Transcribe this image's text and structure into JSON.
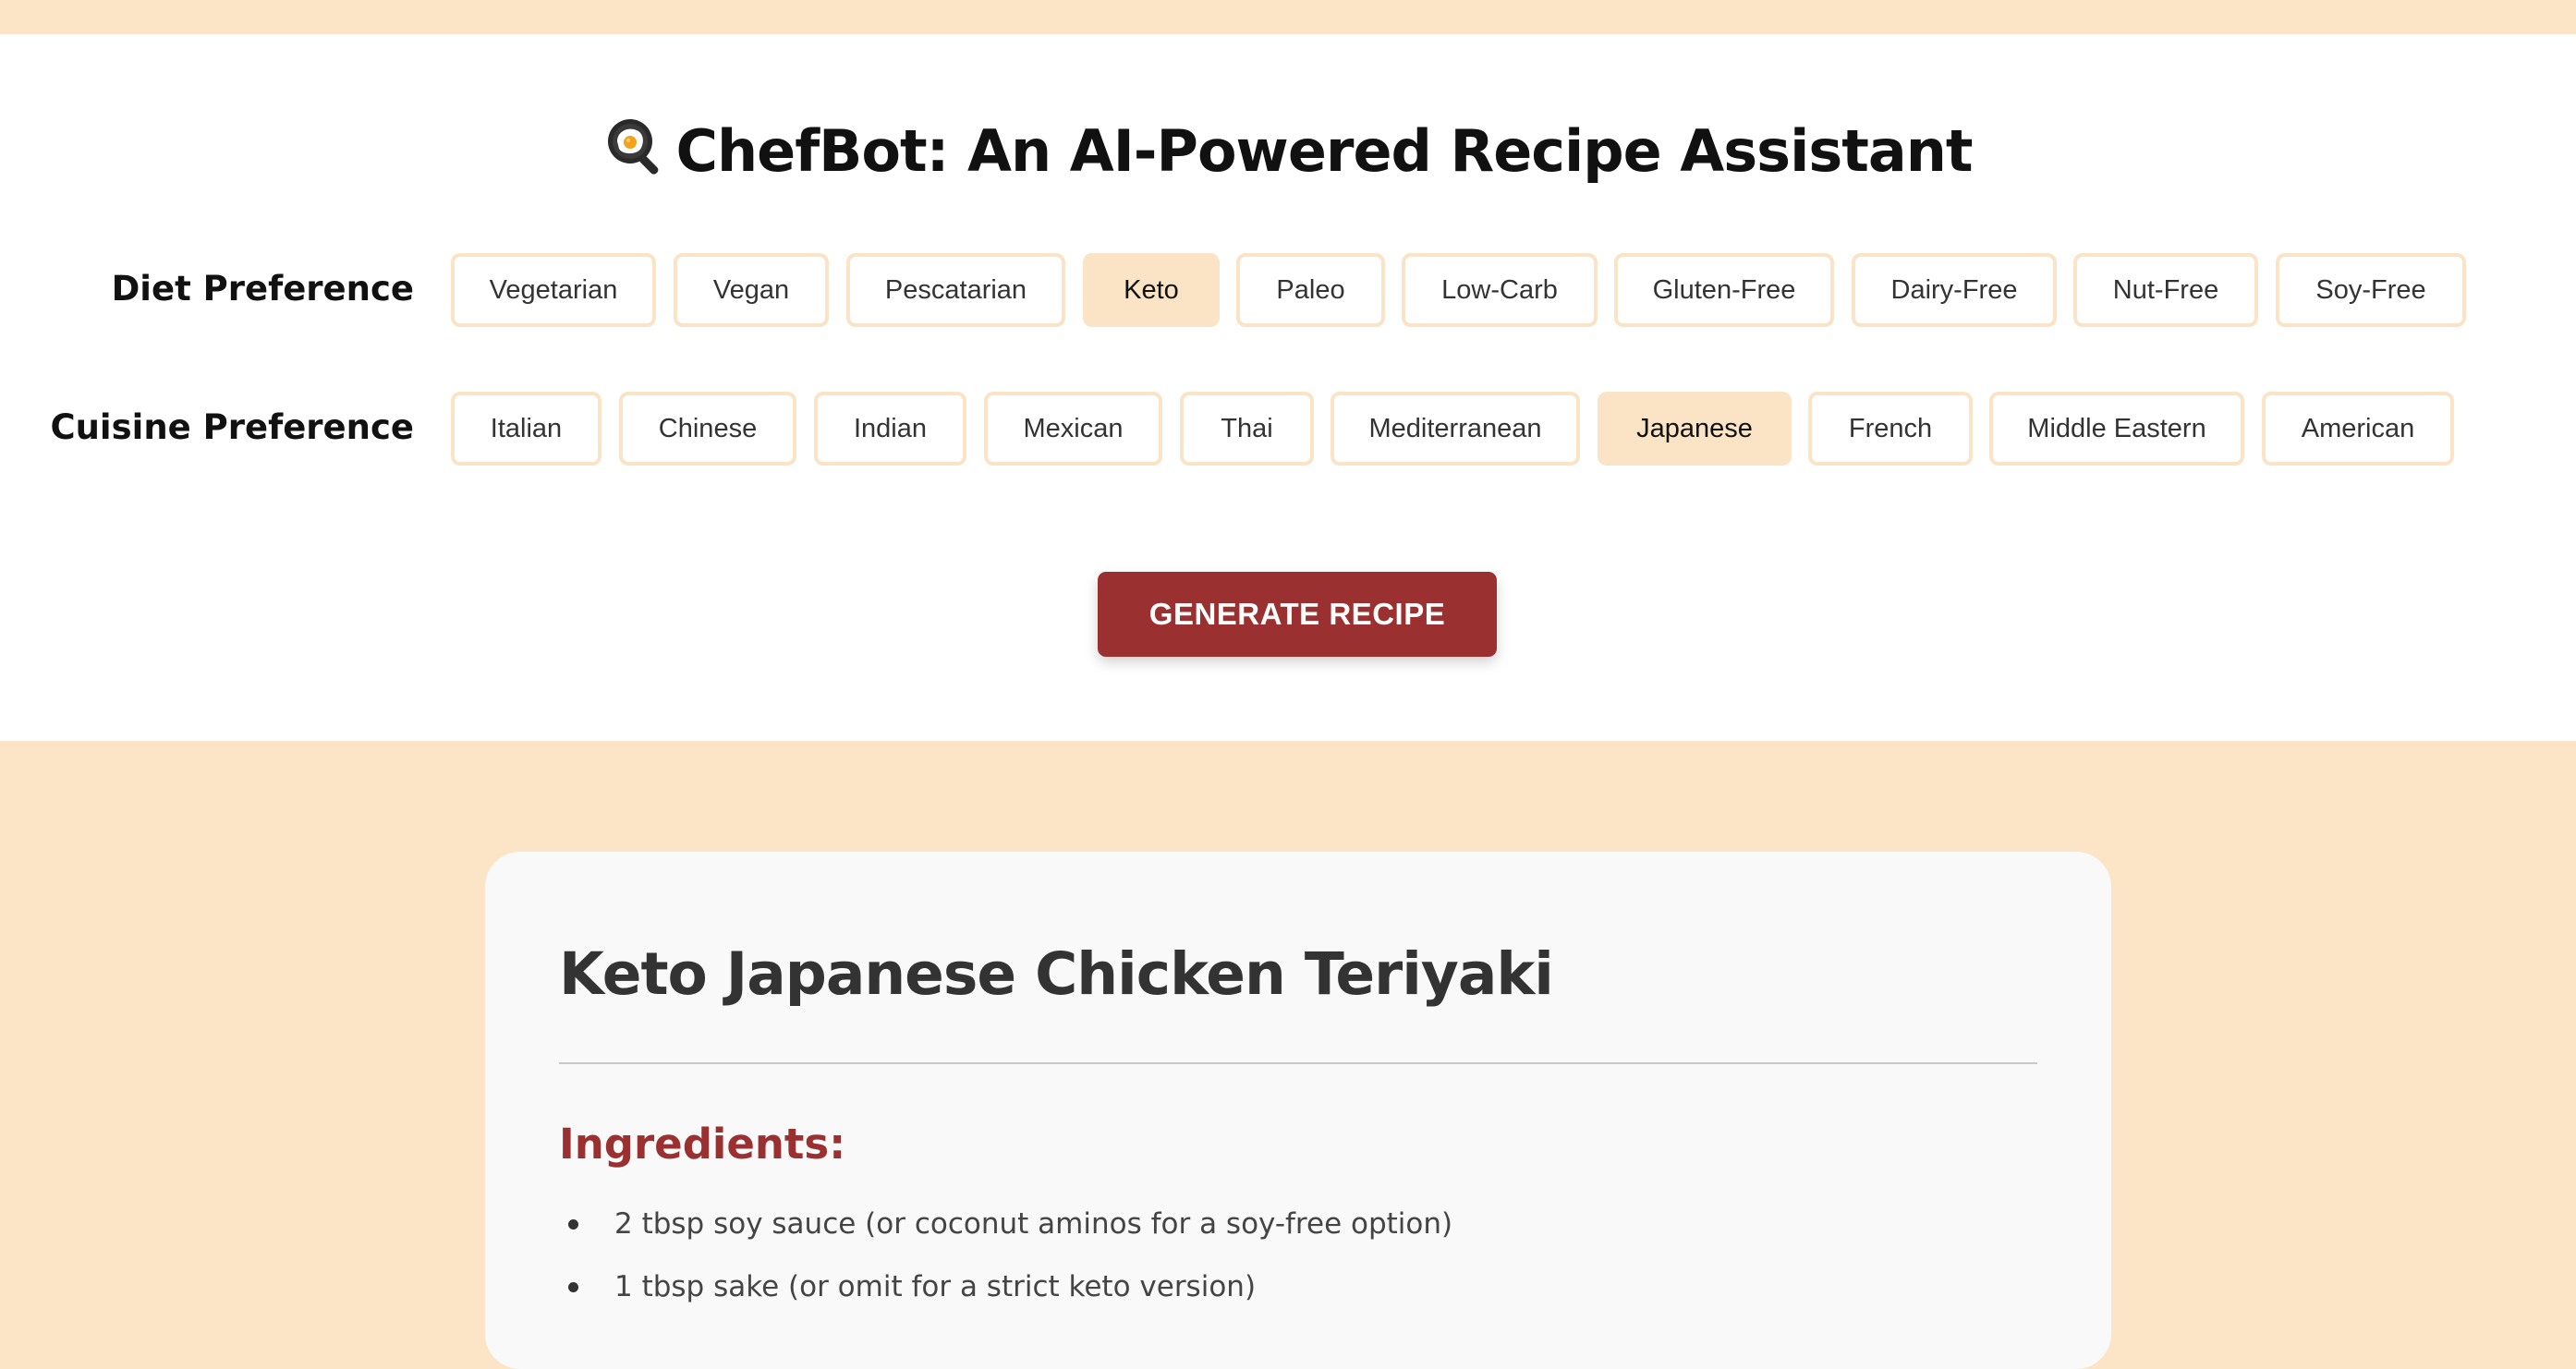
{
  "app": {
    "title": "ChefBot: An AI-Powered Recipe Assistant",
    "title_icon": "frying-pan-egg-icon"
  },
  "diet": {
    "label": "Diet Preference",
    "options": [
      "Vegetarian",
      "Vegan",
      "Pescatarian",
      "Keto",
      "Paleo",
      "Low-Carb",
      "Gluten-Free",
      "Dairy-Free",
      "Nut-Free",
      "Soy-Free"
    ],
    "selected": "Keto"
  },
  "cuisine": {
    "label": "Cuisine Preference",
    "options": [
      "Italian",
      "Chinese",
      "Indian",
      "Mexican",
      "Thai",
      "Mediterranean",
      "Japanese",
      "French",
      "Middle Eastern",
      "American"
    ],
    "selected": "Japanese"
  },
  "actions": {
    "generate_label": "GENERATE RECIPE"
  },
  "recipe": {
    "title": "Keto Japanese Chicken Teriyaki",
    "ingredients_heading": "Ingredients:",
    "ingredients": [
      "2 tbsp soy sauce (or coconut aminos for a soy-free option)",
      "1 tbsp sake (or omit for a strict keto version)"
    ]
  },
  "colors": {
    "background": "#fce4c6",
    "accent": "#9a3030",
    "chip_border": "#fbe3c5",
    "card": "#f9f9f9"
  }
}
